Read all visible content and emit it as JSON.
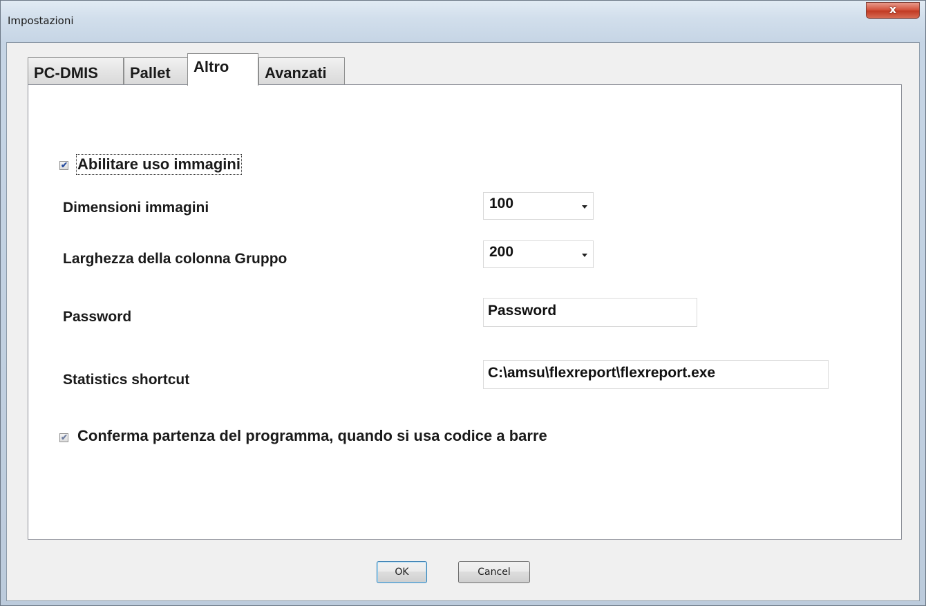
{
  "window": {
    "title": "Impostazioni",
    "close_label": "x"
  },
  "tabs": [
    {
      "label": "PC-DMIS",
      "active": false
    },
    {
      "label": "Pallet",
      "active": false
    },
    {
      "label": "Altro",
      "active": true
    },
    {
      "label": "Avanzati",
      "active": false
    }
  ],
  "settings": {
    "enable_images": {
      "label": "Abilitare uso immagini",
      "checked": true
    },
    "image_size": {
      "label": "Dimensioni immagini",
      "value": "100"
    },
    "group_column_width": {
      "label": "Larghezza della colonna Gruppo",
      "value": "200"
    },
    "password": {
      "label": "Password",
      "value": "Password"
    },
    "statistics_shortcut": {
      "label": "Statistics shortcut",
      "value": "C:\\amsu\\flexreport\\flexreport.exe"
    },
    "confirm_start": {
      "label": "Conferma partenza del programma, quando si usa codice a barre",
      "checked": true
    }
  },
  "buttons": {
    "ok_label": "OK",
    "cancel_label": "Cancel"
  },
  "colors": {
    "checkmark": "#2a4fa0",
    "close_button": "#c23b24",
    "default_button_border": "#3c7fb1"
  }
}
